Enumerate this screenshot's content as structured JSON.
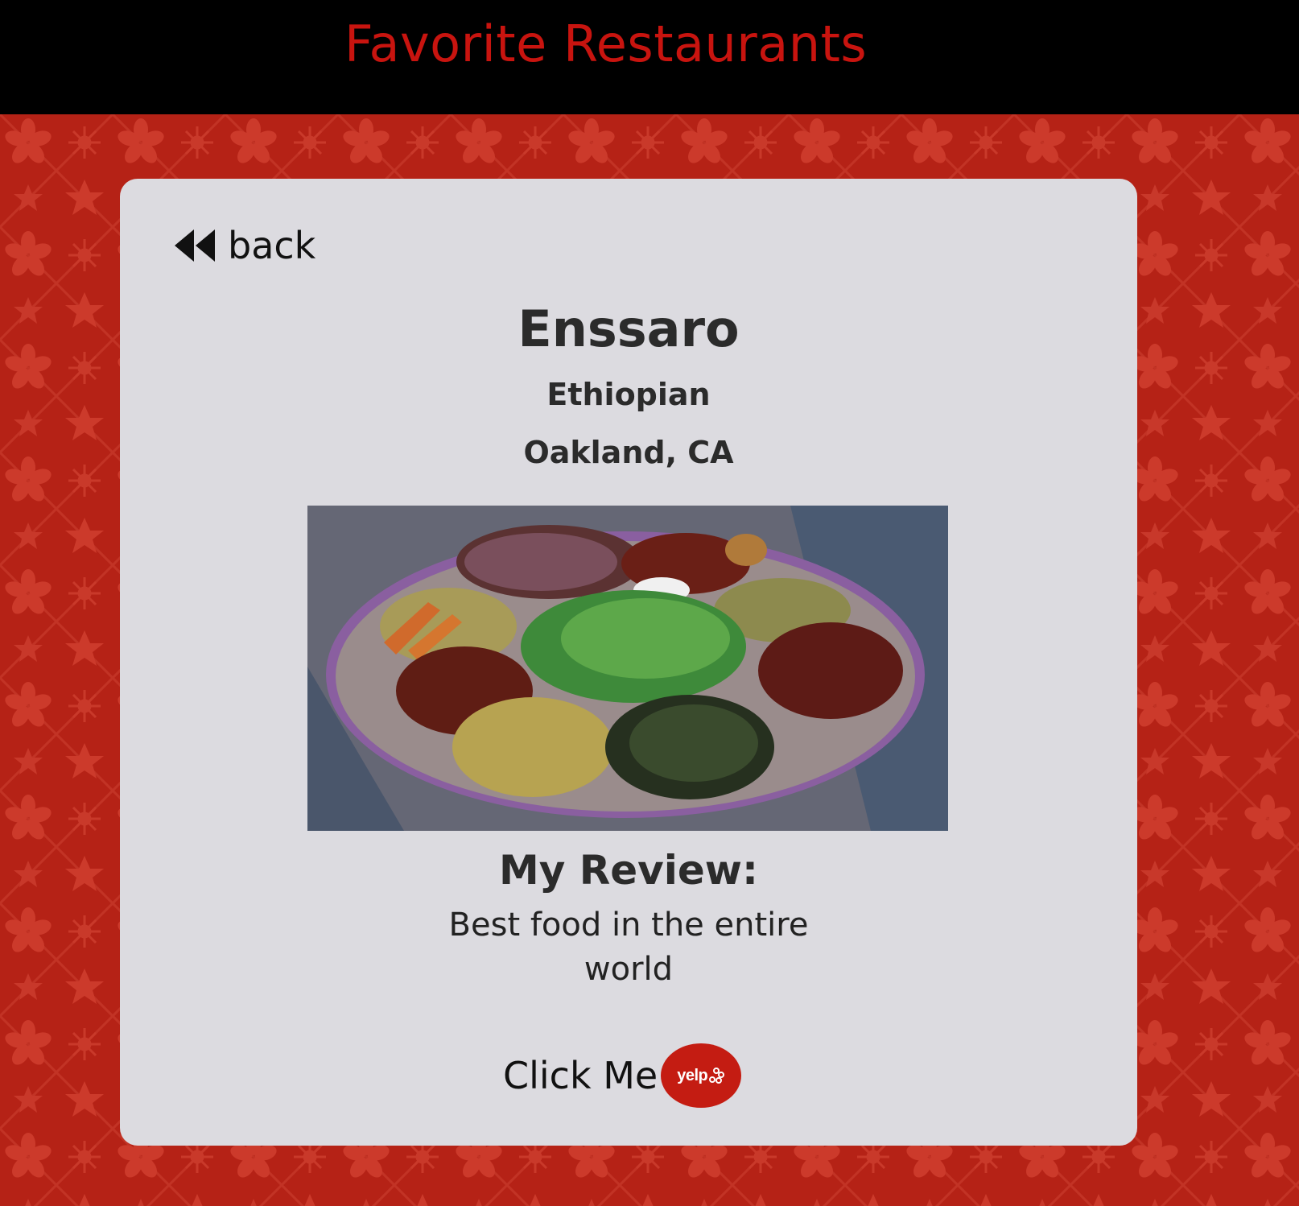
{
  "header": {
    "title": "Favorite Restaurants"
  },
  "theme": {
    "header_bg": "#000000",
    "title_color": "#c8140f",
    "page_bg": "#b52216",
    "card_bg": "#dcdbe0",
    "yelp_red": "#c41c12"
  },
  "card": {
    "back_label": "back",
    "back_icon": "rewind-icon",
    "name": "Enssaro",
    "cuisine": "Ethiopian",
    "location": "Oakland, CA",
    "photo_alt": "Ethiopian combination platter on injera",
    "review_heading": "My Review:",
    "review_text": "Best food in the entire world",
    "yelp_label": "Click Me",
    "yelp_badge_text": "yelp"
  }
}
